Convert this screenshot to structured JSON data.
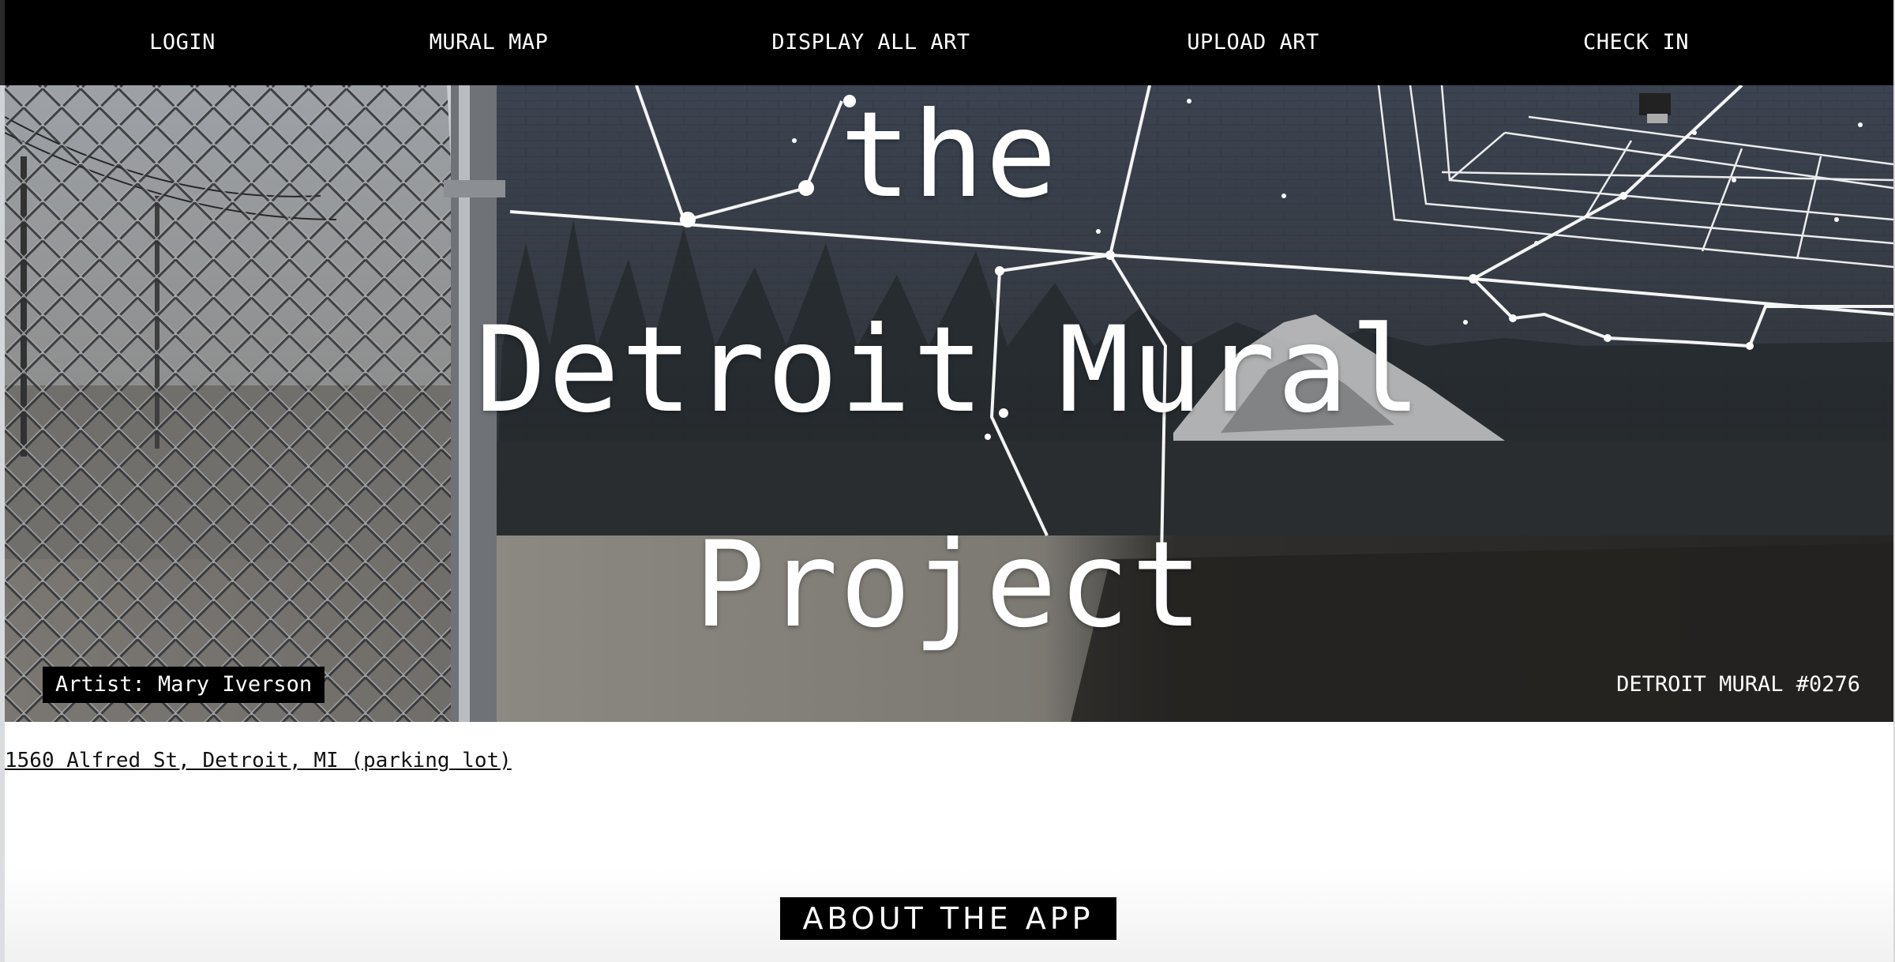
{
  "nav": {
    "items": [
      {
        "label": "LOGIN"
      },
      {
        "label": "MURAL MAP"
      },
      {
        "label": "DISPLAY ALL ART"
      },
      {
        "label": "UPLOAD ART"
      },
      {
        "label": "CHECK IN"
      }
    ]
  },
  "hero": {
    "title_lines": [
      "the",
      "Detroit Mural",
      "Project"
    ],
    "artist_caption": "Artist: Mary Iverson",
    "mural_id": "DETROIT MURAL #0276"
  },
  "address": {
    "text": "1560 Alfred St, Detroit, MI (parking lot)"
  },
  "about_button": {
    "label": "ABOUT THE APP"
  },
  "colors": {
    "nav_background": "#000000",
    "nav_text": "#ffffff",
    "button_background": "#000000",
    "button_text": "#ffffff"
  }
}
